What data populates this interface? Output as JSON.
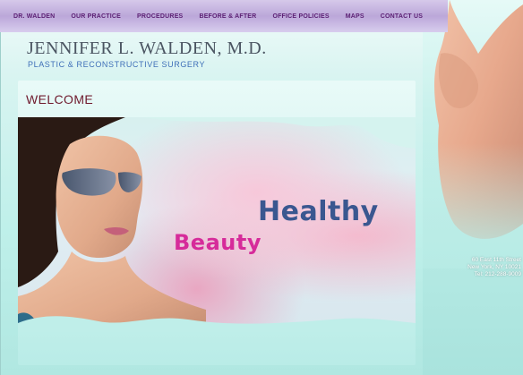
{
  "nav": {
    "items": [
      {
        "label": "DR. WALDEN"
      },
      {
        "label": "OUR PRACTICE"
      },
      {
        "label": "PROCEDURES"
      },
      {
        "label": "BEFORE & AFTER"
      },
      {
        "label": "OFFICE POLICIES"
      },
      {
        "label": "MAPS"
      },
      {
        "label": "CONTACT US"
      }
    ]
  },
  "header": {
    "doctor_name": "JENNIFER L. WALDEN, M.D.",
    "subtitle": "PLASTIC & RECONSTRUCTIVE SURGERY"
  },
  "main": {
    "heading": "WELCOME",
    "hero": {
      "word_1": "Healthy",
      "word_2": "Beauty"
    }
  },
  "address": {
    "line1": "60 East 11th Street",
    "line2": "New York, NY 10021",
    "line3": "Tel: 212-288-9009"
  },
  "colors": {
    "nav_text": "#5b1f73",
    "heading": "#6f1a2d",
    "healthy": "#3a5790",
    "beauty": "#d62b9a",
    "subtitle": "#3f6fb8"
  }
}
